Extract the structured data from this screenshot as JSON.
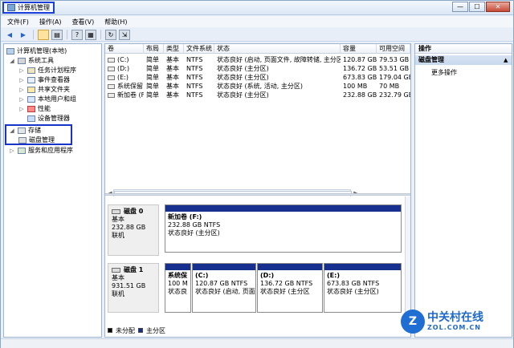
{
  "window": {
    "title": "计算机管理",
    "min": "—",
    "max": "☐",
    "close": "✕"
  },
  "menu": [
    "文件(F)",
    "操作(A)",
    "查看(V)",
    "帮助(H)"
  ],
  "toolbar": {
    "icons": [
      "back-icon",
      "forward-icon",
      "up-icon",
      "show-hide-tree-icon",
      "help-icon",
      "properties-icon",
      "refresh-icon",
      "export-icon"
    ]
  },
  "tree": {
    "root": "计算机管理(本地)",
    "system_tools": "系统工具",
    "task_scheduler": "任务计划程序",
    "event_viewer": "事件查看器",
    "shared_folders": "共享文件夹",
    "local_users": "本地用户和组",
    "performance": "性能",
    "device_manager": "设备管理器",
    "storage": "存储",
    "disk_mgmt": "磁盘管理",
    "services": "服务和应用程序"
  },
  "volumes": {
    "headers": [
      "卷",
      "布局",
      "类型",
      "文件系统",
      "状态",
      "容量",
      "可用空间"
    ],
    "rows": [
      [
        "(C:)",
        "简单",
        "基本",
        "NTFS",
        "状态良好 (启动, 页面文件, 故障转储, 主分区)",
        "120.87 GB",
        "79.53 GB"
      ],
      [
        "(D:)",
        "简单",
        "基本",
        "NTFS",
        "状态良好 (主分区)",
        "136.72 GB",
        "53.51 GB"
      ],
      [
        "(E:)",
        "简单",
        "基本",
        "NTFS",
        "状态良好 (主分区)",
        "673.83 GB",
        "179.04 GB"
      ],
      [
        "系统保留",
        "简单",
        "基本",
        "NTFS",
        "状态良好 (系统, 活动, 主分区)",
        "100 MB",
        "70 MB"
      ],
      [
        "新加卷 (F:)",
        "简单",
        "基本",
        "NTFS",
        "状态良好 (主分区)",
        "232.88 GB",
        "232.79 GB"
      ]
    ]
  },
  "disks": {
    "d0": {
      "name": "磁盘 0",
      "type": "基本",
      "size": "232.88 GB",
      "status": "联机",
      "p1": {
        "name": "新加卷  (F:)",
        "size": "232.88 GB NTFS",
        "status": "状态良好 (主分区)"
      }
    },
    "d1": {
      "name": "磁盘 1",
      "type": "基本",
      "size": "931.51 GB",
      "status": "联机",
      "p1": {
        "name": "系统保",
        "size": "100 M",
        "status": "状态良"
      },
      "p2": {
        "name": "(C:)",
        "size": "120.87 GB NTFS",
        "status": "状态良好 (启动, 页面"
      },
      "p3": {
        "name": "(D:)",
        "size": "136.72 GB NTFS",
        "status": "状态良好 (主分区"
      },
      "p4": {
        "name": "(E:)",
        "size": "673.83 GB NTFS",
        "status": "状态良好 (主分区)"
      }
    }
  },
  "legend": {
    "unallocated": "未分配",
    "primary": "主分区"
  },
  "colors": {
    "primary": "#172f8f",
    "unallocated": "#000000",
    "highlight_box": "#1833c9"
  },
  "actions": {
    "title": "操作",
    "section": "磁盘管理",
    "more": "更多操作"
  },
  "watermark": {
    "title": "中关村在线",
    "url": "ZOL.COM.CN",
    "mark": "Z"
  }
}
